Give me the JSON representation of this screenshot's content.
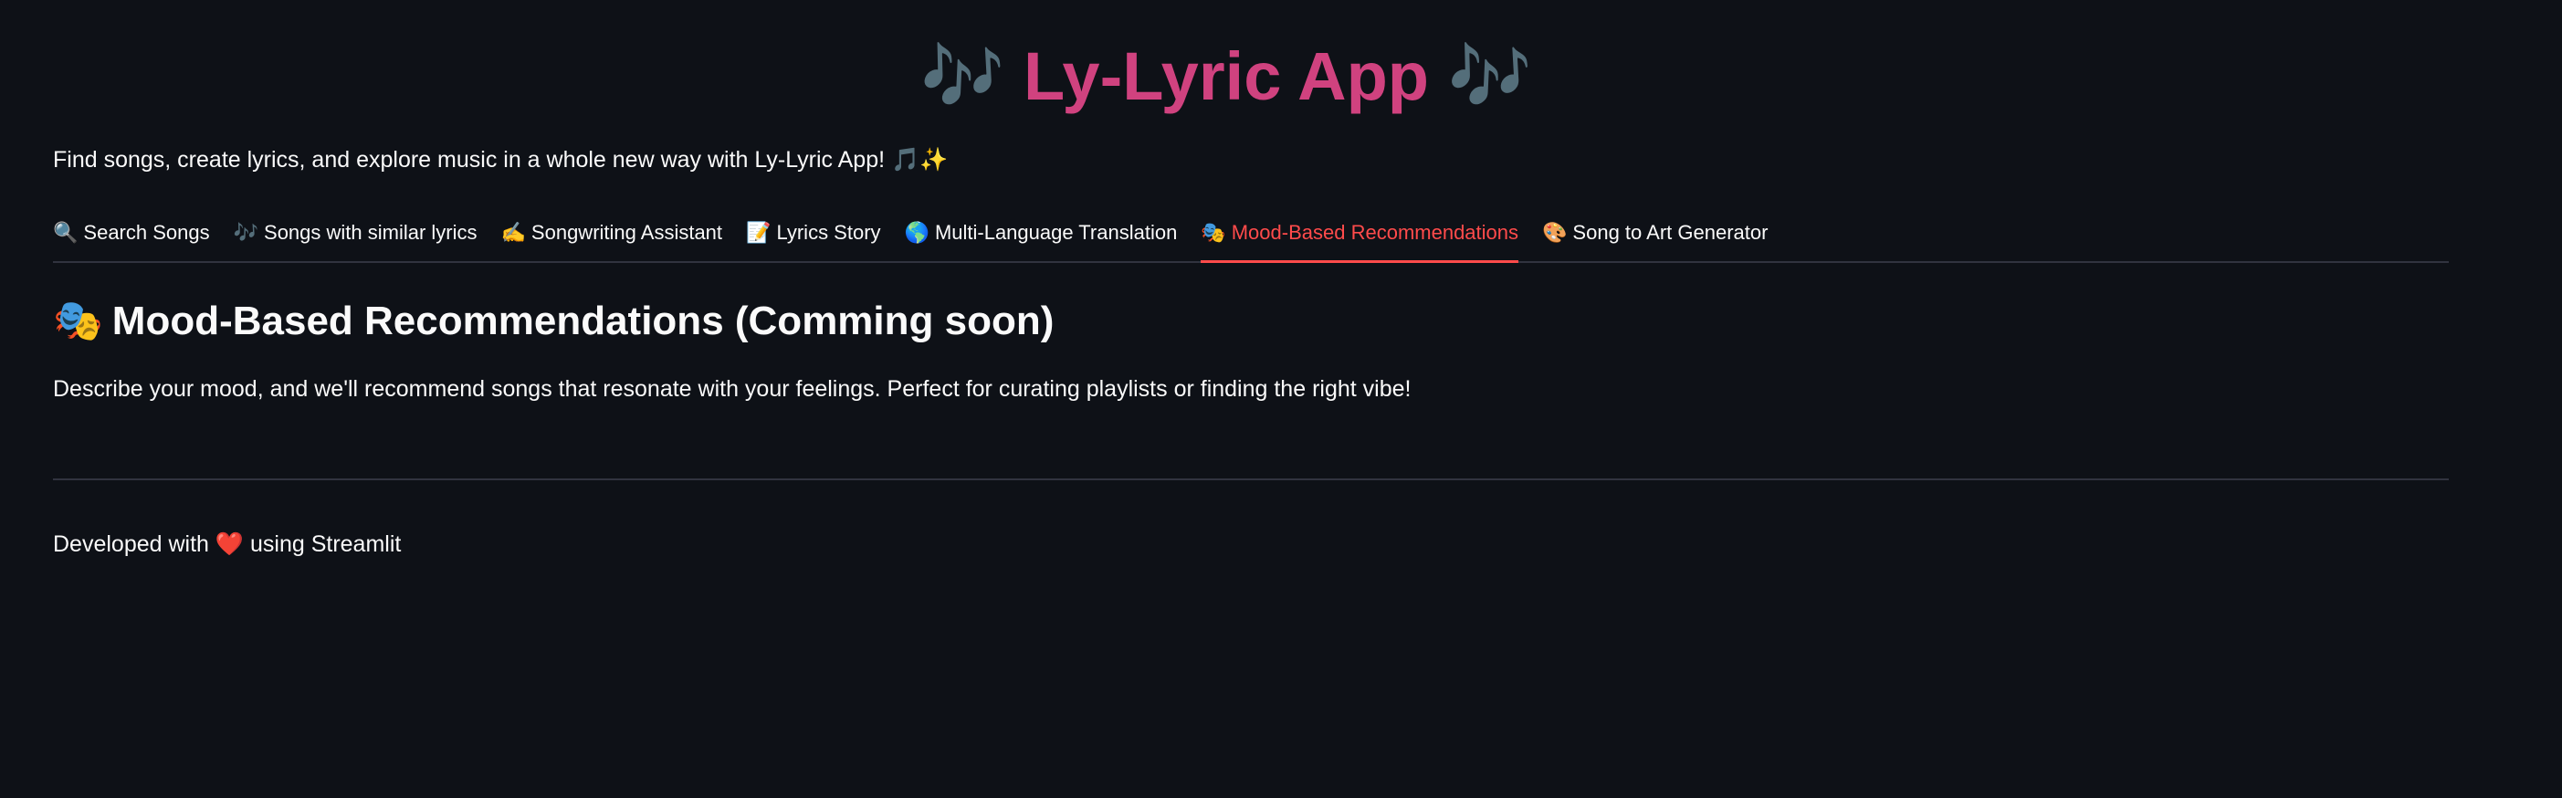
{
  "app": {
    "title_icon": "🎶",
    "title": "Ly-Lyric App",
    "intro": "Find songs, create lyrics, and explore music in a whole new way with Ly-Lyric App! 🎵✨"
  },
  "tabs": [
    {
      "icon": "🔍",
      "label": "Search Songs",
      "active": false
    },
    {
      "icon": "🎶",
      "label": "Songs with similar lyrics",
      "active": false
    },
    {
      "icon": "✍️",
      "label": "Songwriting Assistant",
      "active": false
    },
    {
      "icon": "📝",
      "label": "Lyrics Story",
      "active": false
    },
    {
      "icon": "🌎",
      "label": "Multi-Language Translation",
      "active": false
    },
    {
      "icon": "🎭",
      "label": "Mood-Based Recommendations",
      "active": true
    },
    {
      "icon": "🎨",
      "label": "Song to Art Generator",
      "active": false
    }
  ],
  "section": {
    "icon": "🎭",
    "heading": "Mood-Based Recommendations (Comming soon)",
    "description": "Describe your mood, and we'll recommend songs that resonate with your feelings. Perfect for curating playlists or finding the right vibe!"
  },
  "footer": {
    "prefix": "Developed with",
    "heart": "❤️",
    "suffix": "using Streamlit"
  },
  "colors": {
    "background": "#0e1117",
    "title": "#d0427f",
    "active_tab": "#ff4b4b",
    "divider": "#31333f"
  }
}
